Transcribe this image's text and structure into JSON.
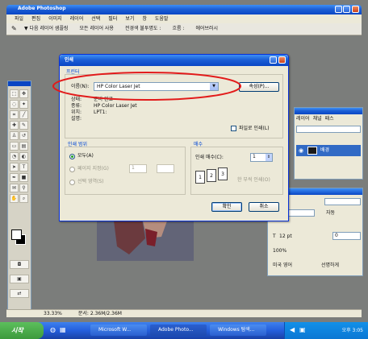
{
  "app": {
    "title": "Adobe Photoshop",
    "menu": [
      "파일",
      "편집",
      "이미지",
      "레이어",
      "선택",
      "필터",
      "보기",
      "창",
      "도움말"
    ],
    "options_bar": [
      "▼ 다음 레이어 샘플링",
      "모든 레이어 사용",
      "전경색 불투명도 :",
      "흐름 :",
      "에어브러시"
    ]
  },
  "dialog": {
    "title": "인쇄",
    "group_printer": "프린터",
    "printer_label": "이름(N):",
    "printer_value": "HP Color Laser Jet",
    "properties_button": "속성(P)...",
    "status_label": "상태:",
    "status_value": "준비 완료",
    "type_label": "종류:",
    "type_value": "HP Color Laser Jet",
    "where_label": "위치:",
    "where_value": "LPT1:",
    "comment_label": "설명:",
    "print_to_file_label": "파일로 인쇄(L)",
    "group_range": "인쇄 범위",
    "range_all": "모두(A)",
    "range_pages": "페이지 지정(G)",
    "range_from": "1",
    "range_to": "",
    "range_selection": "선택 영역(S)",
    "group_copies": "매수",
    "copies_label": "인쇄 매수(C):",
    "copies_value": "1",
    "collate_label": "한 부씩 인쇄(O)",
    "collate_pages": [
      "1",
      "2",
      "3"
    ],
    "ok_button": "확인",
    "cancel_button": "취소"
  },
  "layers_panel": {
    "tabs": [
      "레이어",
      "채널",
      "패스"
    ],
    "layer_name": "배경"
  },
  "char_panel": {
    "size_label": "T",
    "size_value": "12 pt",
    "leading_label": "자동",
    "tracking_value": "0",
    "scale_value": "100%",
    "lang_value": "미국 영어",
    "aa_value": "선명하게"
  },
  "statusbar": {
    "zoom": "33.33%",
    "doc_info": "문서: 2.36M/2.36M"
  },
  "taskbar": {
    "start_label": "시작",
    "buttons": [
      "Microsoft W...",
      "Adobe Photo...",
      "Windows 탐색..."
    ],
    "clock": "오후 3:05"
  },
  "colors": {
    "desktop_gray": "#7b7d7b",
    "xp_blue": "#0a46c4",
    "start_green": "#3c9a3c",
    "highlight_red": "#e21b1b"
  }
}
